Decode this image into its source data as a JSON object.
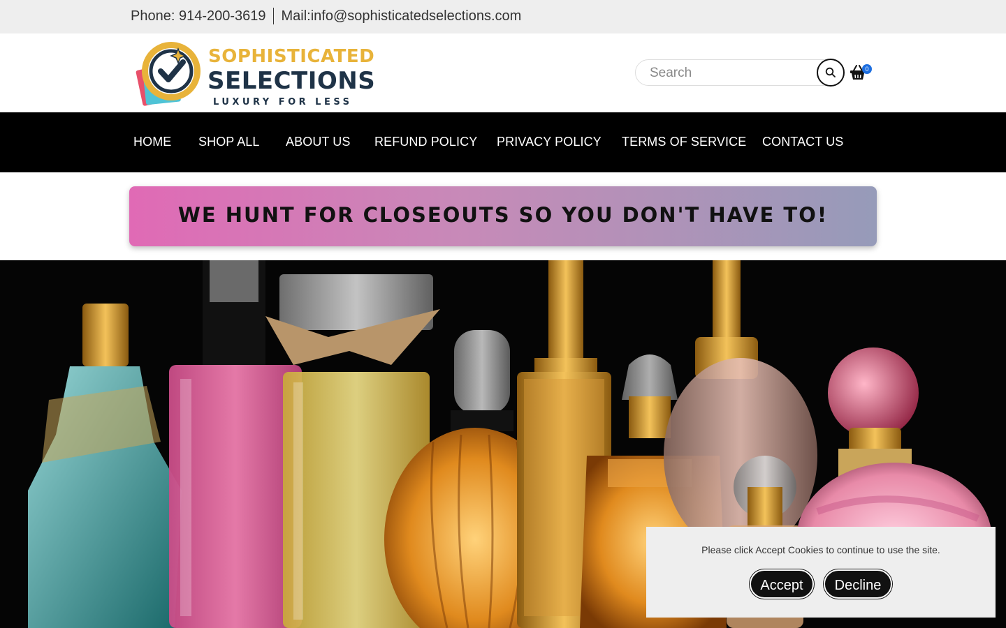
{
  "topbar": {
    "phone": "Phone: 914-200-3619",
    "mail": "Mail:info@sophisticatedselections.com"
  },
  "logo": {
    "line1": "SOPHISTICATED",
    "line2": "SELECTIONS",
    "tagline": "LUXURY FOR LESS"
  },
  "search": {
    "placeholder": "Search",
    "icon": "search-icon"
  },
  "cart": {
    "icon": "basket-icon",
    "count": "0"
  },
  "nav": {
    "items": [
      {
        "label": "HOME"
      },
      {
        "label": "SHOP ALL"
      },
      {
        "label": "ABOUT US"
      },
      {
        "label": "REFUND POLICY"
      },
      {
        "label": "PRIVACY POLICY"
      },
      {
        "label": "TERMS OF SERVICE"
      },
      {
        "label": "CONTACT US"
      }
    ]
  },
  "banner": {
    "text": "WE HUNT FOR CLOSEOUTS SO YOU DON'T HAVE TO!"
  },
  "cookie": {
    "message": "Please click Accept Cookies to continue to use the site.",
    "accept_label": "Accept",
    "decline_label": "Decline"
  },
  "colors": {
    "nav_bg": "#000000",
    "brand_gold": "#e8b33a",
    "brand_navy": "#1f3347",
    "badge_blue": "#1e6fe0",
    "banner_gradient_start": "#e06ab5",
    "banner_gradient_end": "#969bb9"
  }
}
